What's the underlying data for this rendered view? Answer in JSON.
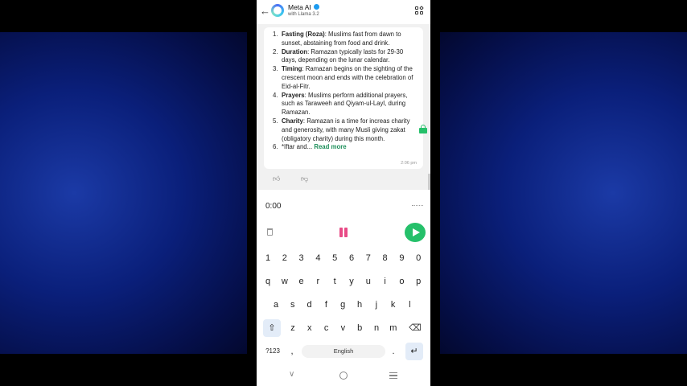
{
  "header": {
    "title": "Meta AI",
    "subtitle": "with Llama 3.2"
  },
  "message": {
    "items": [
      {
        "num": "1.",
        "bold": "Fasting (Roza)",
        "text": ": Muslims fast from dawn to sunset, abstaining from food and drink."
      },
      {
        "num": "2.",
        "bold": "Duration",
        "text": ": Ramazan typically lasts for 29-30 days, depending on the lunar calendar."
      },
      {
        "num": "3.",
        "bold": "Timing",
        "text": ": Ramazan begins on the sighting of the crescent moon and ends with the celebration of Eid-al-Fitr."
      },
      {
        "num": "4.",
        "bold": "Prayers",
        "text": ": Muslims perform additional prayers, such as Taraweeh and Qiyam-ul-Layl, during Ramazan."
      },
      {
        "num": "5.",
        "bold": "Charity",
        "text": ": Ramazan is a time for increas charity and generosity, with many Musli giving zakat (obligatory charity) during this month."
      }
    ],
    "last_item_num": "6.",
    "last_item_text": "*Iftar and...",
    "read_more": "Read more",
    "time": "2:06 pm"
  },
  "recorder": {
    "time": "0:00"
  },
  "keyboard": {
    "row_numbers": [
      "1",
      "2",
      "3",
      "4",
      "5",
      "6",
      "7",
      "8",
      "9",
      "0"
    ],
    "row1": [
      "q",
      "w",
      "e",
      "r",
      "t",
      "y",
      "u",
      "i",
      "o",
      "p"
    ],
    "row2": [
      "a",
      "s",
      "d",
      "f",
      "g",
      "h",
      "j",
      "k",
      "l"
    ],
    "row3": [
      "z",
      "x",
      "c",
      "v",
      "b",
      "n",
      "m"
    ],
    "symbols_label": "?123",
    "comma": ",",
    "space_label": "English",
    "period": "."
  },
  "colors": {
    "accent_green": "#25c06a",
    "pause_pink": "#e84a86",
    "link_green": "#1d8f5a"
  }
}
